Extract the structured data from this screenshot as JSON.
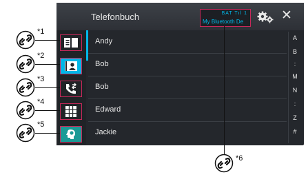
{
  "header": {
    "title": "Telefonbuch",
    "device_name": "My Bluetooth De",
    "status_icons": "BAT  Tıl  1"
  },
  "contacts": [
    "Andy",
    "Bob",
    "Bob",
    "Edward",
    "Jackie"
  ],
  "index_letters": [
    "A",
    "B",
    ":",
    "M",
    "N",
    ":",
    "Z",
    "#"
  ],
  "callouts": [
    "*1",
    "*2",
    "*3",
    "*4",
    "*5",
    "*6"
  ],
  "colors": {
    "accent": "#00b7e8",
    "highlight": "#c8285a",
    "screen_bg": "#24272c"
  }
}
